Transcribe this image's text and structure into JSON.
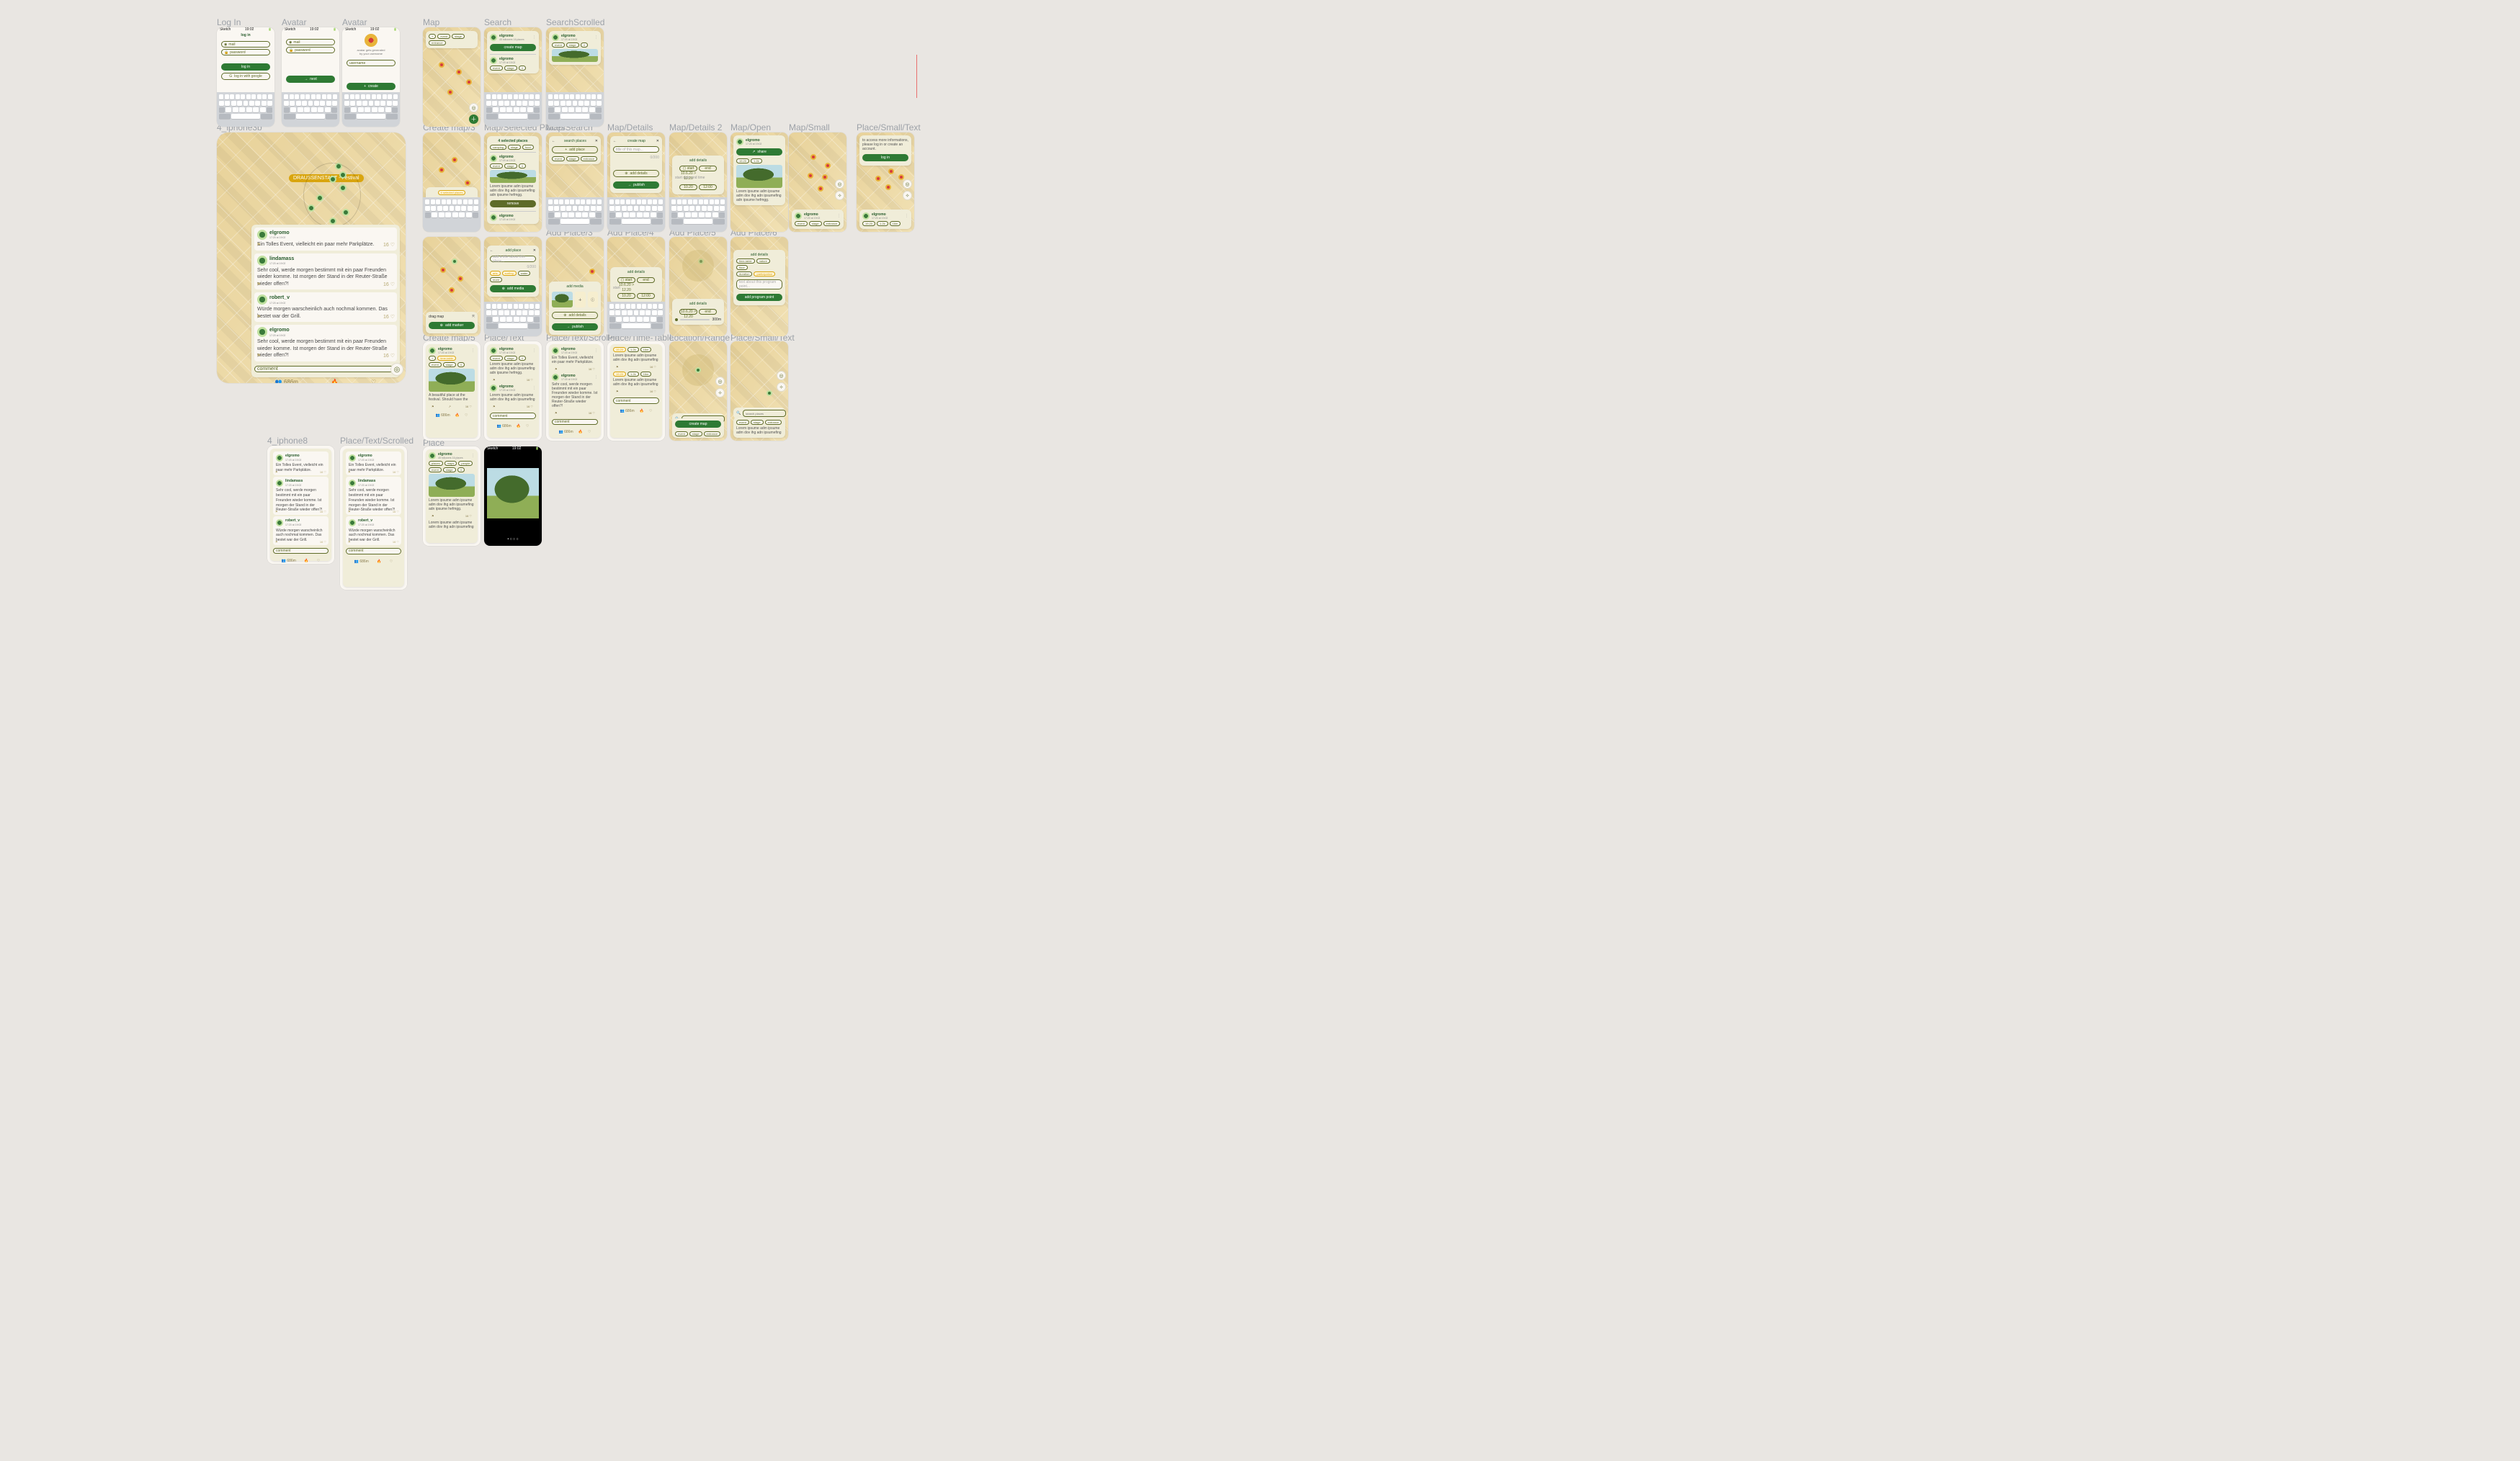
{
  "labels": {
    "login": "Log In",
    "avatar1": "Avatar",
    "avatar2": "Avatar",
    "map": "Map",
    "search": "Search",
    "searchScrolled": "SearchScrolled",
    "createMap3": "Create map/3",
    "selectedPlaces": "Map/Selected Places",
    "mapSearch": "Map/Search",
    "mapDetails": "Map/Details",
    "mapDetails2": "Map/Details 2",
    "mapOpen": "Map/Open",
    "mapSmall": "Map/Small",
    "placeSmallText": "Place/Small/Text",
    "addPlace3": "Add Place/3",
    "addPlace4": "Add Place/4",
    "addPlace5": "Add Place/5",
    "addPlace6": "Add Place/6",
    "createMap5": "Create map/5",
    "placeText": "Place/Text",
    "placeTextScrolled": "Place/Text/Scrolled",
    "placeTimeTable": "Place/Time-Table",
    "locationRange": "Location/Range",
    "placeSmallTextB": "Place/Small/Text",
    "place": "Place",
    "iphone3b": "4_iphone3b",
    "iphone8": "4_iphone8"
  },
  "time": "19:02",
  "carrier": "Sketch",
  "sLogin": {
    "title": "log in",
    "mail": "mail",
    "password": "password",
    "btn": "log in",
    "google": "log in with google"
  },
  "sAvatar1": {
    "mail": "mail",
    "password": "password",
    "next": "next"
  },
  "sAvatar2": {
    "line1": "avatar gets generated",
    "line2": "by your username",
    "placeholder": "username",
    "create": "create"
  },
  "user": {
    "name": "elgromo",
    "meta": "17:20 at 19:02",
    "followers": "45 followers 16 places"
  },
  "chips": {
    "event": "event",
    "stage": "stage",
    "entrance": "entrance",
    "explore": "explore",
    "placesC": "places",
    "mapsC": "maps",
    "people": "people",
    "camping": "camping",
    "food": "food",
    "plus": "+",
    "four": "4",
    "selected": "4 selected places",
    "arts": "arts",
    "surfing": "surfing",
    "water": "water",
    "more": "more",
    "timeTable": "time-table",
    "nature": "nature",
    "floor": "floor",
    "duration": "duration",
    "participation": "participation",
    "timeTableB": "time-table"
  },
  "actions": {
    "createMap": "create map",
    "addTitle": "add title",
    "addPlace": "add place",
    "addMarker": "add marker",
    "addMedia": "add media",
    "addDetails": "add details",
    "publish": "publish",
    "share": "share",
    "addProgramPoint": "add program point",
    "searchTerm": "search term",
    "searchPlaces": "search places",
    "explore": "explore",
    "dragMap": "drag map",
    "comment": "comment",
    "logIn": "log in"
  },
  "lipsum": "Lorem ipsume adm ipsume adm dov ihg adn ipsumefing adn ipsume hefmgg.",
  "lipsumShort": "Lorem ipsume adm ipsume adm dov ihg adn ipsumefing",
  "photoCaption": "A beautiful place at the festival. Should have the",
  "count": "686m",
  "accessMsg": "to access more informations, please log in or create an account.",
  "timings": {
    "start": "start",
    "end": "end",
    "range": "10.6.20 > 12.20",
    "d1": "10.20",
    "t1": "12:00"
  },
  "big": {
    "tag": "DRAUSSENSTADT - Festival",
    "e1": {
      "name": "elgromo",
      "txt": "Ein Tolles Event, vielleicht ein paar mehr Parkplätze."
    },
    "e2": {
      "name": "lindamass",
      "txt": "Sehr cool, werde morgen bestimmt mit ein paar Freunden wieder komme. Ist morgen der Stand in der Reuter-Straße wieder offen?!"
    },
    "e3": {
      "name": "robert_v",
      "txt": "Würde morgen warscheinlich auch nochmal kommen. Das bestet war der Grill."
    },
    "e4": {
      "name": "elgromo",
      "txt": "Sehr cool, werde morgen bestimmt mit ein paar Freunden wieder komme. Ist morgen der Stand in der Reuter-Straße wieder offen?!"
    }
  },
  "row": {
    "likes": "16",
    "d1": "1.2k"
  },
  "stats": {
    "d1": "19.20",
    "d2": "1.2k",
    "d3": "16m"
  },
  "addPlaceSheet": {
    "title": "add place",
    "ph": "add a title about this place...",
    "count": "0/200"
  },
  "searchSheet": {
    "title": "search places"
  },
  "detailsSheet": {
    "title": "create map",
    "sub": "title of this map...",
    "maxD": "0/200"
  },
  "range": "300m"
}
